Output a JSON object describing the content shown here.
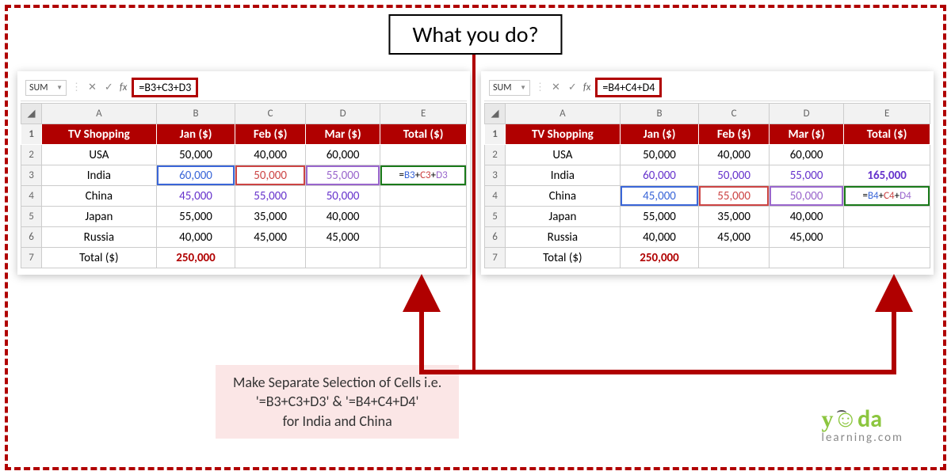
{
  "title": "What you do?",
  "caption": {
    "line1": "Make Separate Selection of Cells i.e.",
    "line2": "'=B3+C3+D3' & '=B4+C4+D4'",
    "line3": "for India and China"
  },
  "left": {
    "namebox": "SUM",
    "formula": "=B3+C3+D3",
    "cols": [
      "A",
      "B",
      "C",
      "D",
      "E"
    ],
    "headers": [
      "TV Shopping",
      "Jan ($)",
      "Feb ($)",
      "Mar ($)",
      "Total ($)"
    ],
    "rows": [
      {
        "n": "2",
        "c": [
          "USA",
          "50,000",
          "40,000",
          "60,000",
          ""
        ]
      },
      {
        "n": "3",
        "c": [
          "India",
          "60,000",
          "50,000",
          "55,000",
          "=B3+C3+D3"
        ]
      },
      {
        "n": "4",
        "c": [
          "China",
          "45,000",
          "55,000",
          "50,000",
          ""
        ]
      },
      {
        "n": "5",
        "c": [
          "Japan",
          "55,000",
          "35,000",
          "40,000",
          ""
        ]
      },
      {
        "n": "6",
        "c": [
          "Russia",
          "40,000",
          "45,000",
          "45,000",
          ""
        ]
      },
      {
        "n": "7",
        "c": [
          "Total ($)",
          "250,000",
          "",
          "",
          ""
        ]
      }
    ]
  },
  "right": {
    "namebox": "SUM",
    "formula": "=B4+C4+D4",
    "cols": [
      "A",
      "B",
      "C",
      "D",
      "E"
    ],
    "headers": [
      "TV Shopping",
      "Jan ($)",
      "Feb ($)",
      "Mar ($)",
      "Total ($)"
    ],
    "rows": [
      {
        "n": "2",
        "c": [
          "USA",
          "50,000",
          "40,000",
          "60,000",
          ""
        ]
      },
      {
        "n": "3",
        "c": [
          "India",
          "60,000",
          "50,000",
          "55,000",
          "165,000"
        ]
      },
      {
        "n": "4",
        "c": [
          "China",
          "45,000",
          "55,000",
          "50,000",
          "=B4+C4+D4"
        ]
      },
      {
        "n": "5",
        "c": [
          "Japan",
          "55,000",
          "35,000",
          "40,000",
          ""
        ]
      },
      {
        "n": "6",
        "c": [
          "Russia",
          "40,000",
          "45,000",
          "45,000",
          ""
        ]
      },
      {
        "n": "7",
        "c": [
          "Total ($)",
          "250,000",
          "",
          "",
          ""
        ]
      }
    ]
  },
  "logo": {
    "brand": "yoda",
    "sub": "learning.com"
  }
}
